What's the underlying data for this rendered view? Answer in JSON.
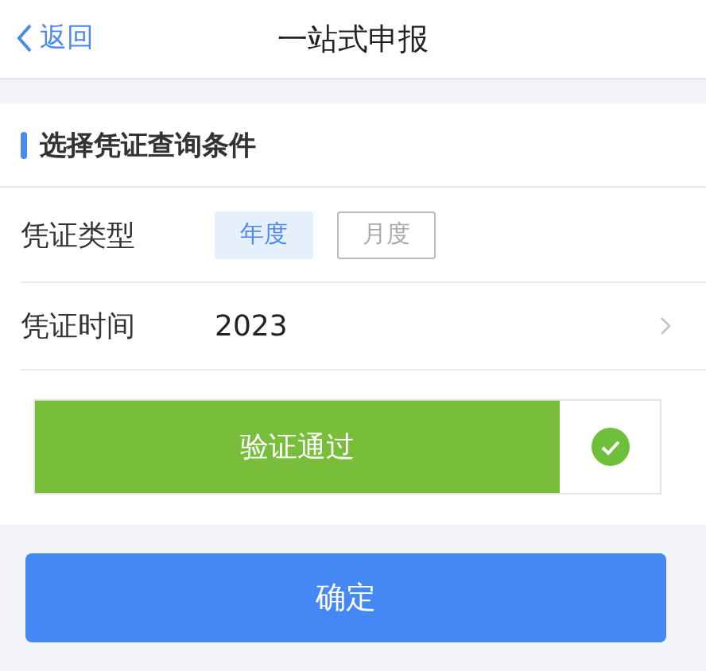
{
  "nav": {
    "back": "返回",
    "title": "一站式申报"
  },
  "section": {
    "title": "选择凭证查询条件"
  },
  "type_row": {
    "label": "凭证类型",
    "options": [
      {
        "label": "年度",
        "selected": true
      },
      {
        "label": "月度",
        "selected": false
      }
    ]
  },
  "time_row": {
    "label": "凭证时间",
    "value": "2023"
  },
  "verify": {
    "label": "验证通过",
    "passed": true
  },
  "confirm": "确定"
}
